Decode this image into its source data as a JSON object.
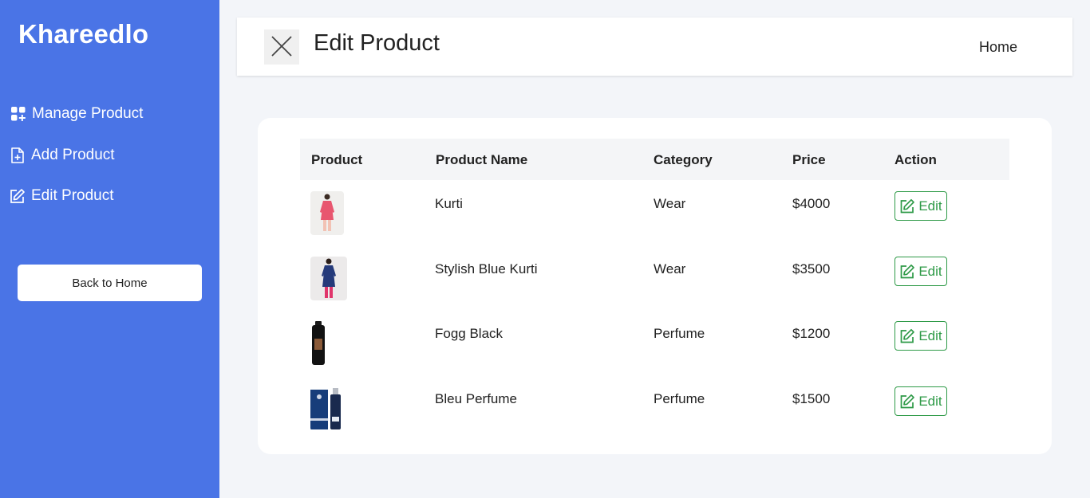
{
  "sidebar": {
    "brand": "Khareedlo",
    "items": [
      {
        "label": "Manage Product",
        "icon": "grid-plus-icon"
      },
      {
        "label": "Add Product",
        "icon": "file-plus-icon"
      },
      {
        "label": "Edit Product",
        "icon": "pencil-square-icon"
      }
    ],
    "back_button": "Back to Home"
  },
  "header": {
    "title": "Edit Product",
    "close_icon": "close-icon",
    "home_link": "Home"
  },
  "table": {
    "columns": [
      "Product",
      "Product Name",
      "Category",
      "Price",
      "Action"
    ],
    "rows": [
      {
        "name": "Kurti",
        "category": "Wear",
        "price": "$4000",
        "action": "Edit",
        "image": "pink-kurti-image"
      },
      {
        "name": "Stylish Blue Kurti",
        "category": "Wear",
        "price": "$3500",
        "action": "Edit",
        "image": "blue-kurti-image"
      },
      {
        "name": "Fogg Black",
        "category": "Perfume",
        "price": "$1200",
        "action": "Edit",
        "image": "black-perfume-image"
      },
      {
        "name": "Bleu Perfume",
        "category": "Perfume",
        "price": "$1500",
        "action": "Edit",
        "image": "blue-perfume-image"
      }
    ]
  },
  "colors": {
    "sidebar": "#4a74e6",
    "background": "#f3f5f9",
    "edit_green": "#2e9a47"
  }
}
